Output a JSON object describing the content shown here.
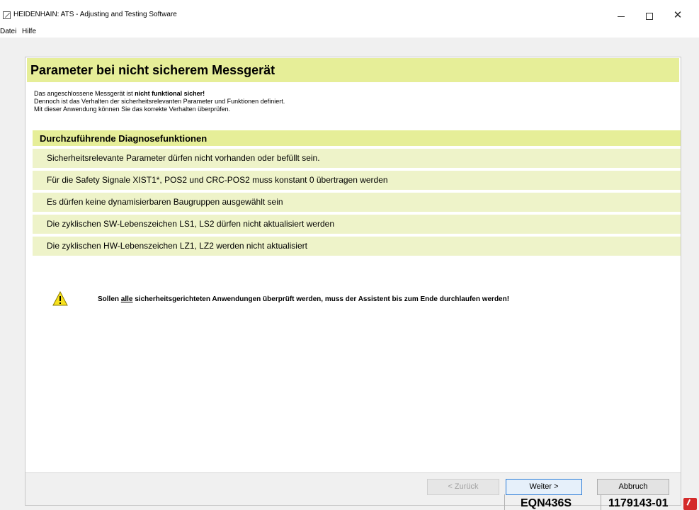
{
  "window": {
    "title": "HEIDENHAIN: ATS - Adjusting and Testing Software",
    "minimize": "–",
    "maximize": "□",
    "close": "✕"
  },
  "menu": {
    "items": [
      "Datei",
      "Hilfe"
    ]
  },
  "page": {
    "heading": "Parameter bei nicht sicherem Messgerät",
    "intro_line1_prefix": "Das angeschlossene Messgerät ist ",
    "intro_line1_bold": "nicht funktional sicher!",
    "intro_line2": "Dennoch ist das Verhalten der sicherheitsrelevanten Parameter und Funktionen definiert.",
    "intro_line3": "Mit dieser Anwendung können Sie das korrekte Verhalten überprüfen.",
    "diagnostics_title": "Durchzuführende Diagnosefunktionen",
    "diagnostics": [
      "Sicherheitsrelevante Parameter dürfen nicht vorhanden oder befüllt sein.",
      "Für die Safety Signale XIST1*, POS2 und CRC-POS2 muss konstant 0 übertragen werden",
      "Es dürfen keine dynamisierbaren Baugruppen ausgewählt sein",
      "Die zyklischen SW-Lebenszeichen LS1, LS2 dürfen nicht aktualisiert werden",
      "Die zyklischen HW-Lebenszeichen LZ1, LZ2 werden nicht aktualisiert"
    ],
    "warning_prefix": "Sollen ",
    "warning_underlined": "alle",
    "warning_suffix": " sicherheitsgerichteten Anwendungen überprüft werden, muss der Assistent bis zum Ende durchlaufen werden!"
  },
  "buttons": {
    "back": "< Zurück",
    "next": "Weiter >",
    "cancel": "Abbruch"
  },
  "status": {
    "model": "EQN436S",
    "id": "1179143-01"
  },
  "colors": {
    "header_bg": "#e6ee98",
    "item_bg": "#eef3c9",
    "status_icon": "#d42a2a"
  }
}
